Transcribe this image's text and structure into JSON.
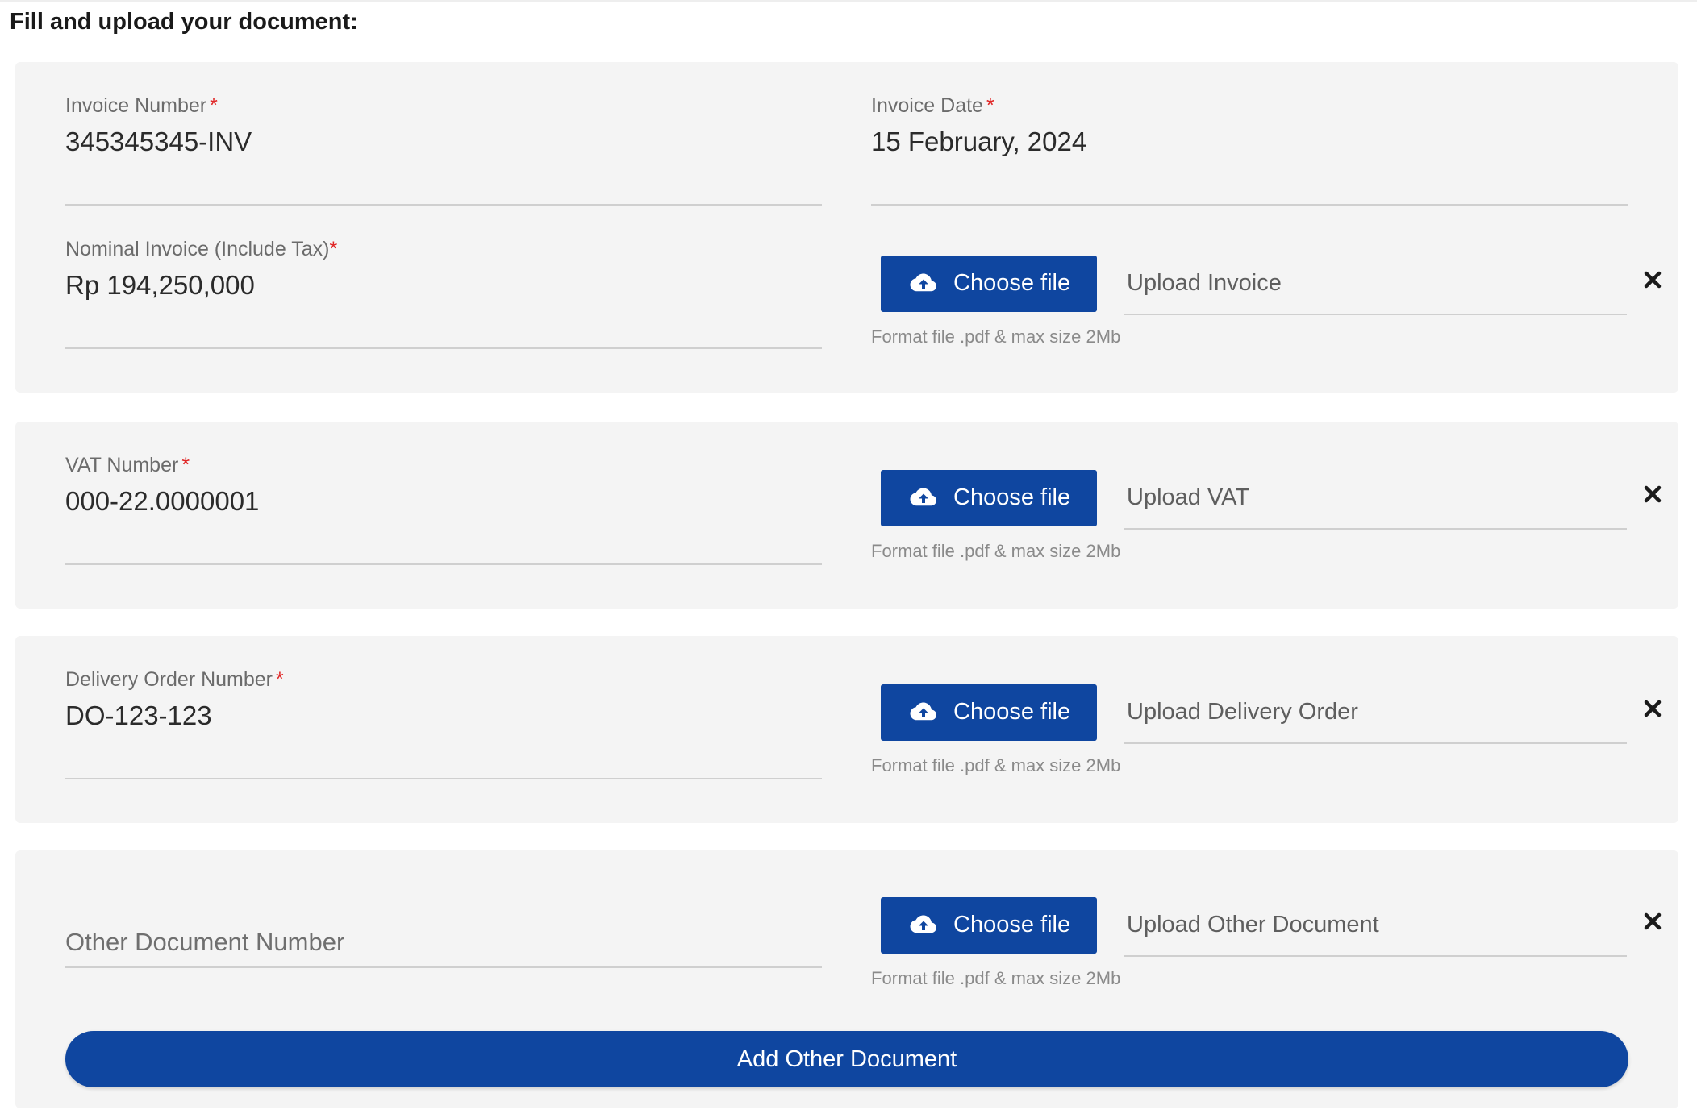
{
  "header": {
    "title": "Fill and upload your document:"
  },
  "colors": {
    "primary": "#0f46a0",
    "card_bg": "#f4f4f4",
    "required": "#e02424"
  },
  "invoice": {
    "number_label": "Invoice Number",
    "number_value": "345345345-INV",
    "date_label": "Invoice Date",
    "date_value": "15 February, 2024",
    "nominal_label": "Nominal Invoice (Include Tax)",
    "nominal_value": "Rp 194,250,000",
    "upload_button": "Choose file",
    "upload_placeholder": "Upload Invoice",
    "upload_hint": "Format file .pdf & max size 2Mb"
  },
  "vat": {
    "label": "VAT Number",
    "value": "000-22.0000001",
    "upload_button": "Choose file",
    "upload_placeholder": "Upload VAT",
    "upload_hint": "Format file .pdf & max size 2Mb"
  },
  "delivery": {
    "label": "Delivery Order Number",
    "value": "DO-123-123",
    "upload_button": "Choose file",
    "upload_placeholder": "Upload Delivery Order",
    "upload_hint": "Format file .pdf & max size 2Mb"
  },
  "other": {
    "placeholder": "Other Document Number",
    "upload_button": "Choose file",
    "upload_placeholder": "Upload Other Document",
    "upload_hint": "Format file .pdf & max size 2Mb",
    "add_button": "Add Other Document"
  },
  "icons": {
    "upload": "cloud-upload-icon",
    "remove": "close-icon"
  },
  "required_mark": "*"
}
